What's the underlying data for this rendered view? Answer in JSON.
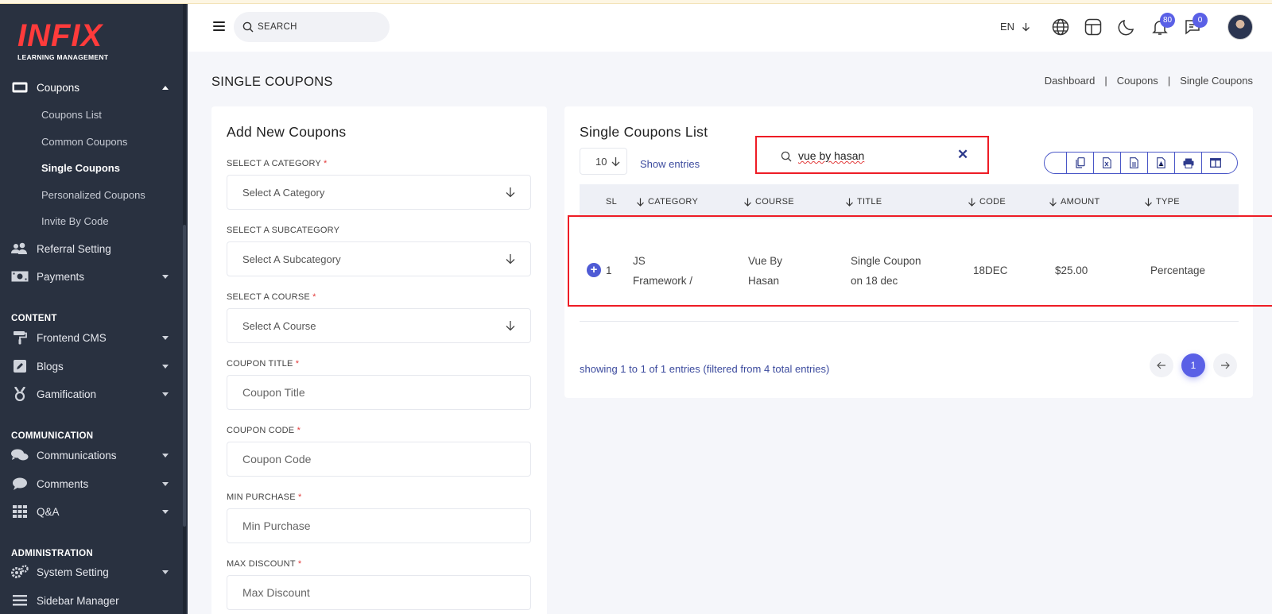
{
  "brand": {
    "logo_text": "INFIX",
    "subtitle": "LEARNING MANAGEMENT"
  },
  "sidebar": {
    "coupons": {
      "label": "Coupons"
    },
    "coupon_sub": [
      "Coupons List",
      "Common Coupons",
      "Single Coupons",
      "Personalized Coupons",
      "Invite By Code"
    ],
    "referral": {
      "label": "Referral Setting"
    },
    "payments": {
      "label": "Payments"
    },
    "sec_content": "CONTENT",
    "frontend": {
      "label": "Frontend CMS"
    },
    "blogs": {
      "label": "Blogs"
    },
    "gamification": {
      "label": "Gamification"
    },
    "sec_communication": "COMMUNICATION",
    "communications": {
      "label": "Communications"
    },
    "comments": {
      "label": "Comments"
    },
    "qa": {
      "label": "Q&A"
    },
    "sec_administration": "ADMINISTRATION",
    "system": {
      "label": "System Setting"
    },
    "sidebar_manager": {
      "label": "Sidebar Manager"
    }
  },
  "header": {
    "search_label": "SEARCH",
    "lang": "EN",
    "notifications_count": "80",
    "messages_count": "0"
  },
  "page": {
    "title": "SINGLE COUPONS",
    "breadcrumb": [
      "Dashboard",
      "|",
      "Coupons",
      "|",
      "Single Coupons"
    ]
  },
  "form": {
    "title": "Add New Coupons",
    "category_label": "SELECT A CATEGORY",
    "category_ph": "Select A Category",
    "subcategory_label": "SELECT A SUBCATEGORY",
    "subcategory_ph": "Select A Subcategory",
    "course_label": "SELECT A COURSE",
    "course_ph": "Select A Course",
    "coupon_title_label": "COUPON TITLE",
    "coupon_title_ph": "Coupon Title",
    "coupon_code_label": "COUPON CODE",
    "coupon_code_ph": "Coupon Code",
    "min_purchase_label": "MIN PURCHASE",
    "min_purchase_ph": "Min Purchase",
    "max_discount_label": "MAX DISCOUNT",
    "max_discount_ph": "Max Discount",
    "required_mark": "*"
  },
  "list": {
    "title": "Single Coupons List",
    "entries_value": "10",
    "show_entries": "Show entries",
    "search_value": "vue by hasan",
    "columns": [
      "SL",
      "CATEGORY",
      "COURSE",
      "TITLE",
      "CODE",
      "AMOUNT",
      "TYPE"
    ],
    "rows": [
      {
        "sl": "1",
        "category_l1": "JS",
        "category_l2": "Framework /",
        "course_l1": "Vue By",
        "course_l2": "Hasan",
        "title_l1": "Single Coupon",
        "title_l2": "on 18 dec",
        "code": "18DEC",
        "amount": "$25.00",
        "type": "Percentage"
      }
    ],
    "showing": "showing 1 to 1 of 1 entries (filtered from 4 total entries)",
    "current_page": "1"
  },
  "colors": {
    "accent": "#5a60e6",
    "sidebar_bg": "#293140",
    "highlight": "#ee1c25",
    "logo": "#ff3b3b"
  },
  "icons": [
    "menu-icon",
    "search-icon",
    "globe-icon",
    "layout-icon",
    "moon-icon",
    "bell-icon",
    "chat-icon",
    "copy-icon",
    "excel-icon",
    "csv-icon",
    "pdf-icon",
    "print-icon",
    "columns-icon"
  ]
}
